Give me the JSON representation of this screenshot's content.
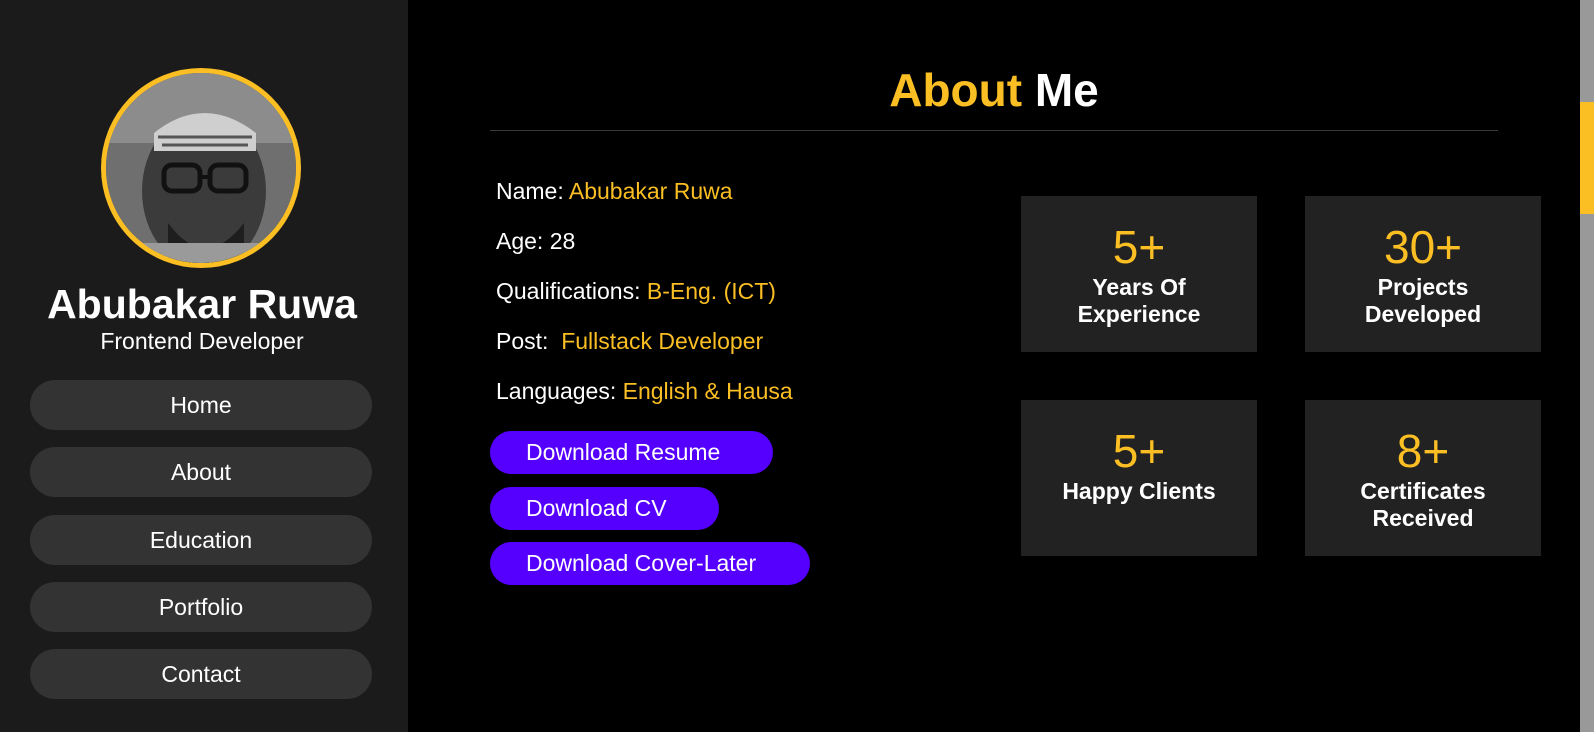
{
  "sidebar": {
    "name": "Abubakar Ruwa",
    "role": "Frontend Developer",
    "nav": [
      "Home",
      "About",
      "Education",
      "Portfolio",
      "Contact"
    ]
  },
  "about": {
    "title_accent": "About",
    "title_rest": "Me",
    "info": [
      {
        "label": "Name: ",
        "value": "Abubakar Ruwa"
      },
      {
        "label": "Age: 28",
        "value": ""
      },
      {
        "label": "Qualifications: ",
        "value": "B-Eng. (ICT)"
      },
      {
        "label": "Post:  ",
        "value": "Fullstack Developer"
      },
      {
        "label": "Languages: ",
        "value": "English & Hausa"
      }
    ],
    "buttons": [
      "Download Resume",
      "Download CV",
      "Download Cover-Later"
    ],
    "stats": [
      {
        "value": "5+",
        "label": "Years Of\nExperience"
      },
      {
        "value": "30+",
        "label": "Projects\nDeveloped"
      },
      {
        "value": "5+",
        "label": "Happy Clients"
      },
      {
        "value": "8+",
        "label": "Certificates\nReceived"
      }
    ]
  },
  "colors": {
    "accent": "#fbbf24",
    "button": "#5500ff",
    "sidebar_bg": "#1b1b1b",
    "card_bg": "#222222"
  },
  "scroll": {
    "position_fraction": 0.15
  }
}
